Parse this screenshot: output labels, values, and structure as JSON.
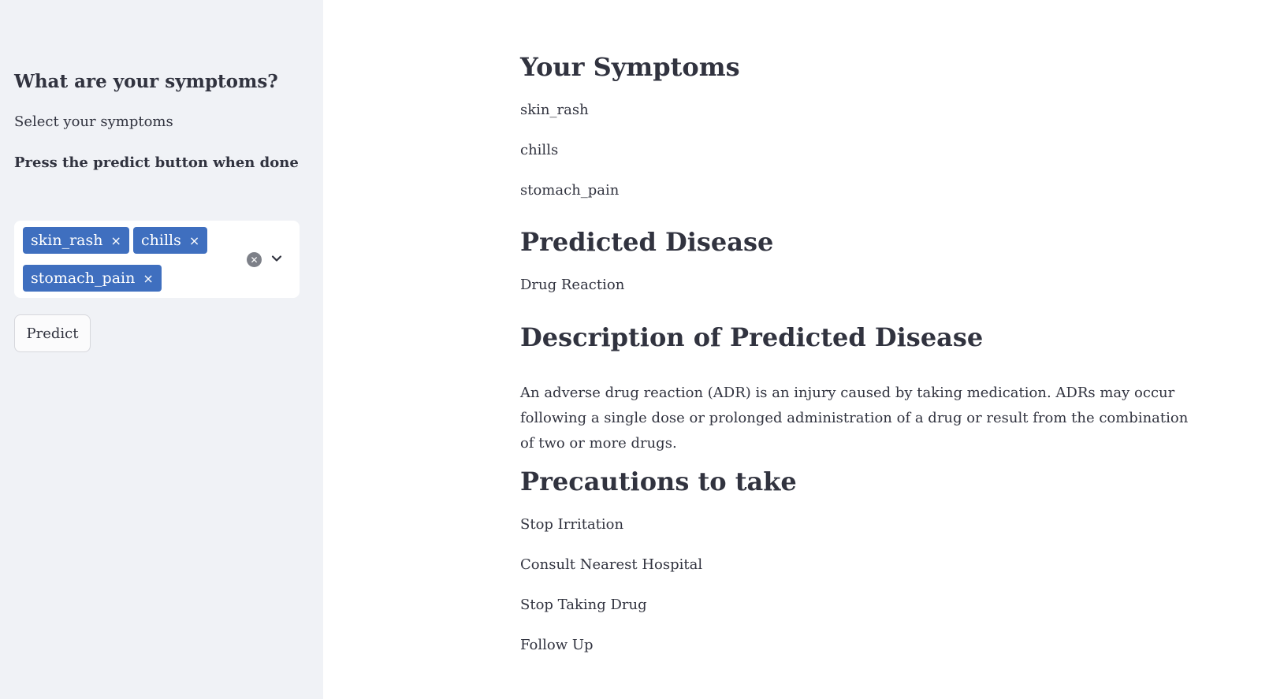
{
  "sidebar": {
    "title": "What are your symptoms?",
    "subtitle": "Select your symptoms",
    "note": "Press the predict button when done",
    "selected_symptoms": [
      "skin_rash",
      "chills",
      "stomach_pain"
    ],
    "remove_glyph": "×",
    "predict_label": "Predict"
  },
  "main": {
    "symptoms_heading": "Your Symptoms",
    "symptoms": [
      "skin_rash",
      "chills",
      "stomach_pain"
    ],
    "disease_heading": "Predicted Disease",
    "disease": "Drug Reaction",
    "description_heading": "Description of Predicted Disease",
    "description": "An adverse drug reaction (ADR) is an injury caused by taking medication. ADRs may occur following a single dose or prolonged administration of a drug or result from the combination of two or more drugs.",
    "precautions_heading": "Precautions to take",
    "precautions": [
      "Stop Irritation",
      "Consult Nearest Hospital",
      "Stop Taking Drug",
      "Follow Up"
    ]
  },
  "colors": {
    "sidebar_bg": "#f0f2f6",
    "tag_bg": "#3f6fbf",
    "text": "#31333f"
  },
  "icons": {
    "clear": "clear-all-icon",
    "dropdown": "chevron-down-icon",
    "remove": "close-icon"
  }
}
